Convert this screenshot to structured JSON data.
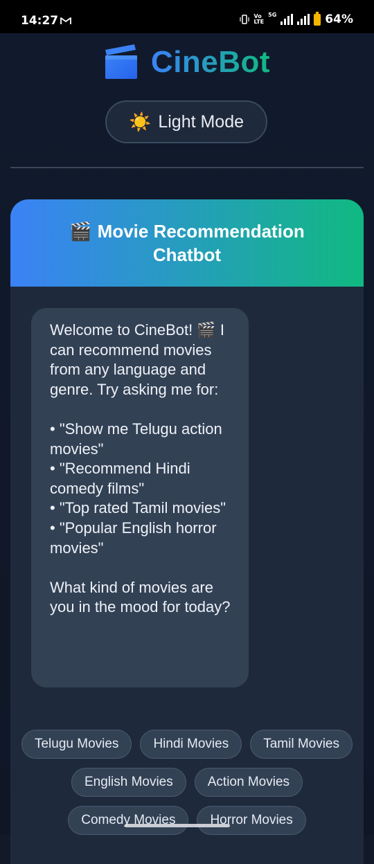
{
  "status_bar": {
    "time": "14:27",
    "mail_icon": "gmail-icon",
    "net_top": "Vo",
    "net_bottom": "LTE",
    "net_5g": "5G",
    "battery_percent": "64%",
    "battery_level": 0.64
  },
  "brand": {
    "name": "CineBot",
    "logo_icon": "clapperboard-icon",
    "gradient_start": "#3b82f6",
    "gradient_end": "#10b981"
  },
  "theme_toggle": {
    "icon": "☀️",
    "label": "Light Mode"
  },
  "chat": {
    "header_icon": "🎬",
    "title": "Movie Recommendation Chatbot",
    "welcome_message": "Welcome to CineBot! 🎬 I can recommend movies from any language and genre. Try asking me for:\n\n• \"Show me Telugu action movies\"\n• \"Recommend Hindi comedy films\"\n• \"Top rated Tamil movies\"\n• \"Popular English horror movies\"\n\nWhat kind of movies are you in the mood for today?"
  },
  "quick_replies": [
    "Telugu Movies",
    "Hindi Movies",
    "Tamil Movies",
    "English Movies",
    "Action Movies",
    "Comedy Movies",
    "Horror Movies"
  ]
}
